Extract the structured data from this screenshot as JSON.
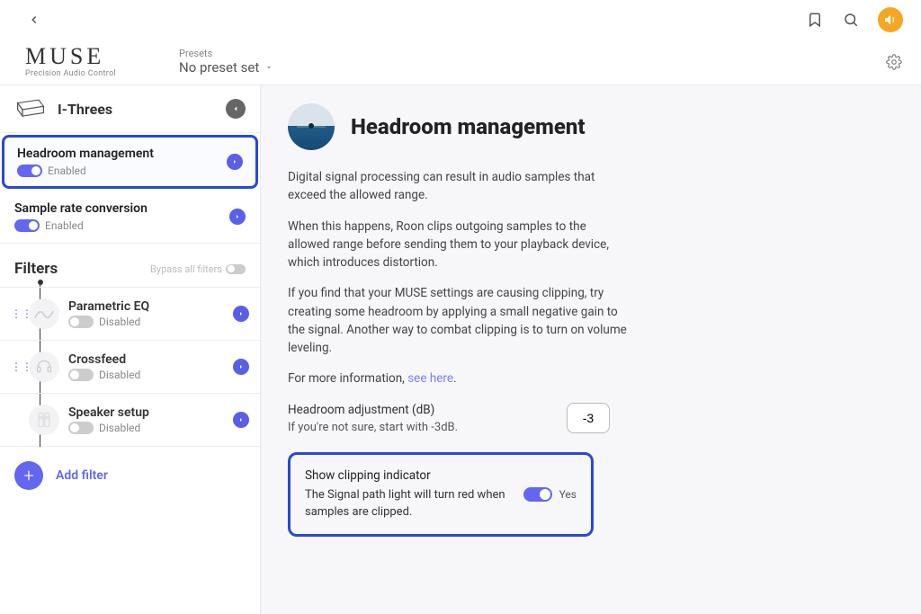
{
  "brand": {
    "name": "MUSE",
    "tagline": "Precision Audio Control"
  },
  "preset": {
    "label": "Presets",
    "value": "No preset set"
  },
  "device": {
    "name": "I-Threes"
  },
  "modules": [
    {
      "title": "Headroom management",
      "status": "Enabled",
      "enabled": true,
      "selected": true
    },
    {
      "title": "Sample rate conversion",
      "status": "Enabled",
      "enabled": true,
      "selected": false
    }
  ],
  "filters": {
    "title": "Filters",
    "bypass_label": "Bypass all filters",
    "items": [
      {
        "title": "Parametric EQ",
        "status": "Disabled",
        "enabled": false,
        "has_handle": true
      },
      {
        "title": "Crossfeed",
        "status": "Disabled",
        "enabled": false,
        "has_handle": true
      },
      {
        "title": "Speaker setup",
        "status": "Disabled",
        "enabled": false,
        "has_handle": false
      }
    ],
    "add_label": "Add filter"
  },
  "detail": {
    "title": "Headroom management",
    "p1": "Digital signal processing can result in audio samples that exceed the allowed range.",
    "p2": "When this happens, Roon clips outgoing samples to the allowed range before sending them to your playback device, which introduces distortion.",
    "p3": "If you find that your MUSE settings are causing clipping, try creating some headroom by applying a small negative gain to the signal. Another way to combat clipping is to turn on volume leveling.",
    "more_prefix": "For more information, ",
    "more_link": "see here",
    "more_suffix": ".",
    "adj_label": "Headroom adjustment (dB)",
    "adj_hint": "If you're not sure, start with -3dB.",
    "adj_value": "-3",
    "clip_title": "Show clipping indicator",
    "clip_desc": "The Signal path light will turn red when samples are clipped.",
    "clip_value": "Yes"
  }
}
